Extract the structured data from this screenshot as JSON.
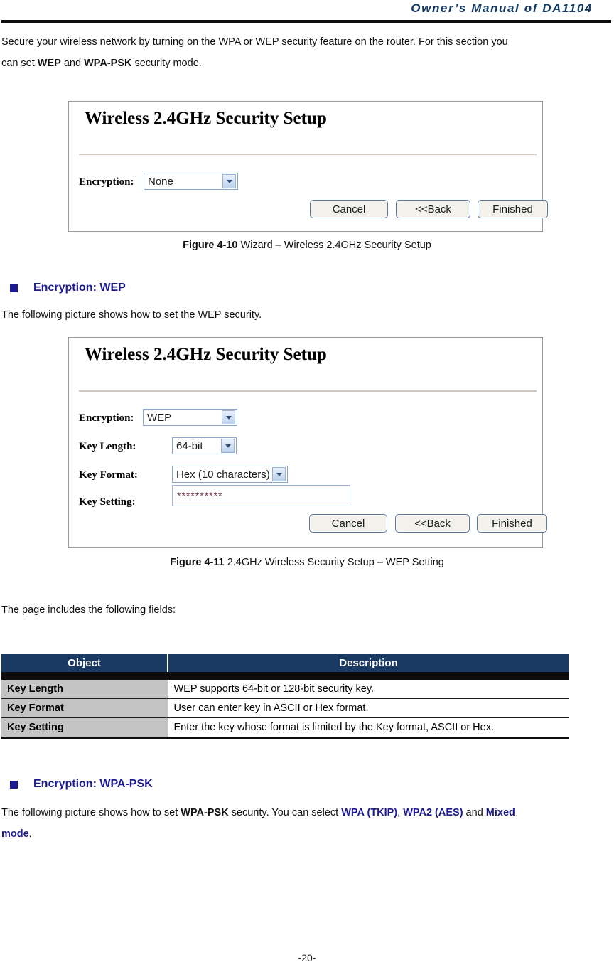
{
  "header": {
    "title": "Owner’s Manual of DA1104"
  },
  "intro": {
    "line1": "Secure your wireless network by turning on the WPA or WEP security feature on the router. For this section you",
    "line2_pre": "can set ",
    "line2_b1": "WEP",
    "line2_mid": " and ",
    "line2_b2": "WPA-PSK",
    "line2_post": " security mode."
  },
  "figure_none": {
    "title": "Wireless 2.4GHz Security Setup",
    "encryption_label": "Encryption:",
    "encryption_value": "None",
    "buttons": {
      "cancel": "Cancel",
      "back": "<<Back",
      "finished": "Finished"
    }
  },
  "caption_410": {
    "bold": "Figure 4-10",
    "rest": " Wizard – Wireless 2.4GHz Security Setup"
  },
  "section_wep": {
    "heading": "Encryption: WEP",
    "body": "The following picture shows how to set the WEP security."
  },
  "figure_wep": {
    "title": "Wireless 2.4GHz Security Setup",
    "encryption_label": "Encryption:",
    "encryption_value": "WEP",
    "key_length_label": "Key Length:",
    "key_length_value": "64-bit",
    "key_format_label": "Key Format:",
    "key_format_value": "Hex (10 characters)",
    "key_setting_label": "Key Setting:",
    "key_setting_value": "**********",
    "buttons": {
      "cancel": "Cancel",
      "back": "<<Back",
      "finished": "Finished"
    }
  },
  "caption_411": {
    "bold": "Figure 4-11",
    "rest": " 2.4GHz Wireless Security Setup – WEP Setting"
  },
  "fields_intro": "The page includes the following fields:",
  "table": {
    "headers": [
      "Object",
      "Description"
    ],
    "rows": [
      [
        "Key Length",
        "WEP supports 64-bit or 128-bit security key."
      ],
      [
        "Key Format",
        "User can enter key in ASCII or Hex format."
      ],
      [
        "Key Setting",
        "Enter the key whose format is limited by the Key format, ASCII or Hex."
      ]
    ]
  },
  "section_wpapsk": {
    "heading": "Encryption: WPA-PSK",
    "line1_pre": "The following picture shows how to set ",
    "line1_b1": "WPA-PSK",
    "line1_mid": " security. You can select ",
    "line1_blue1": "WPA (TKIP)",
    "line1_comma": ", ",
    "line1_blue2": "WPA2 (AES)",
    "line1_and": " and ",
    "line1_blue3": "Mixed",
    "line2_blue": "mode",
    "line2_post": "."
  },
  "footer": {
    "page_number": "-20-"
  }
}
